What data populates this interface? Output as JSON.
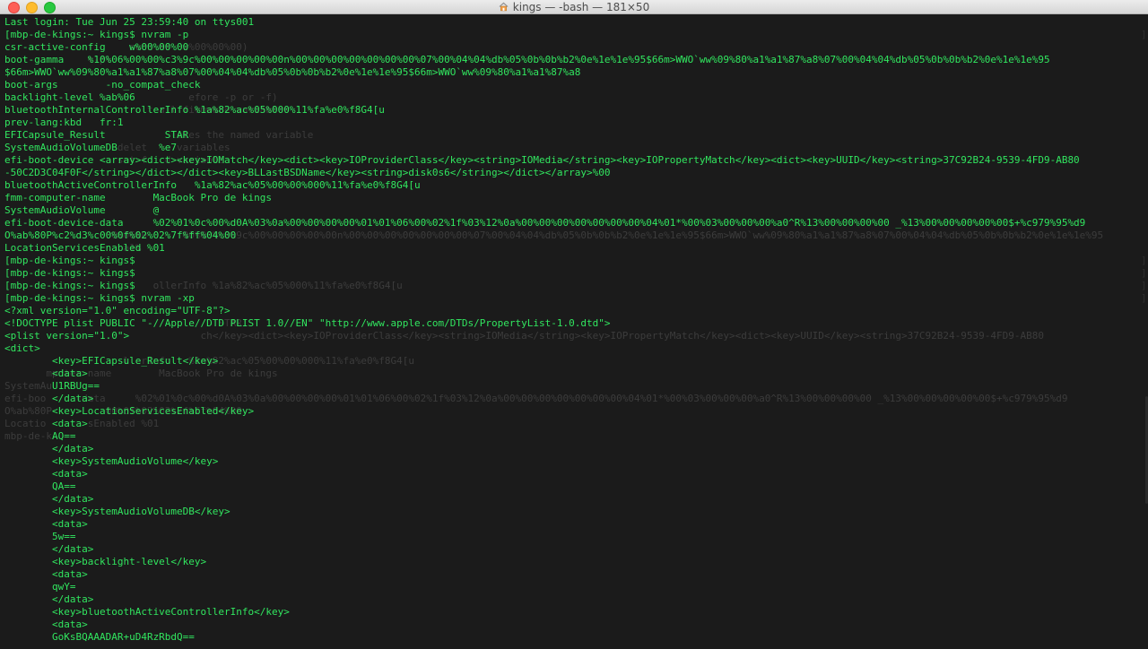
{
  "window": {
    "title": "kings — -bash — 181×50"
  },
  "terminal": {
    "lines": [
      "Last login: Tue Jun 25 23:59:40 on ttys001",
      "[mbp-de-kings:~ kings$ nvram -p",
      "csr-active-config    w%00%00%00",
      "boot-gamma    %10%06%00%00%c3%9c%00%00%00%00%00n%00%00%00%00%00%00%00%07%00%04%04%db%05%0b%0b%b2%0e%1e%1e%95$66m>WWO`ww%09%80%a1%a1%87%a8%07%00%04%04%db%05%0b%0b%b2%0e%1e%1e%95",
      "$66m>WWO`ww%09%80%a1%a1%87%a8%07%00%04%04%db%05%0b%0b%b2%0e%1e%1e%95$66m>WWO`ww%09%80%a1%a1%87%a8",
      "boot-args        -no_compat_check",
      "backlight-level %ab%06",
      "bluetoothInternalControllerInfo %1a%82%ac%05%000%11%fa%e0%f8G4[u",
      "prev-lang:kbd   fr:1",
      "EFICapsule_Result          STAR",
      "SystemAudioVolumeDB       %e7",
      "efi-boot-device <array><dict><key>IOMatch</key><dict><key>IOProviderClass</key><string>IOMedia</string><key>IOPropertyMatch</key><dict><key>UUID</key><string>37C92B24-9539-4FD9-AB80",
      "-50C2D3C04F0F</string></dict></dict><key>BLLastBSDName</key><string>disk0s6</string></dict></array>%00",
      "bluetoothActiveControllerInfo   %1a%82%ac%05%00%00%000%11%fa%e0%f8G4[u",
      "fmm-computer-name        MacBook Pro de kings",
      "SystemAudioVolume        @",
      "efi-boot-device-data     %02%01%0c%00%d0A%03%0a%00%00%00%00%01%01%06%00%02%1f%03%12%0a%00%00%00%00%00%00%00%04%01*%00%03%00%00%00%a0^R%13%00%00%00%00 _%13%00%00%00%00%00$+%c979%95%d9",
      "O%ab%80P%c2%d3%c00%0f%02%02%7f%ff%04%00",
      "LocationServicesEnabled %01",
      "[mbp-de-kings:~ kings$",
      "[mbp-de-kings:~ kings$",
      "[mbp-de-kings:~ kings$",
      "[mbp-de-kings:~ kings$ nvram -xp",
      "<?xml version=\"1.0\" encoding=\"UTF-8\"?>",
      "<!DOCTYPE plist PUBLIC \"-//Apple//DTD PLIST 1.0//EN\" \"http://www.apple.com/DTDs/PropertyList-1.0.dtd\">",
      "<plist version=\"1.0\">",
      "<dict>",
      "        <key>EFICapsule_Result</key>",
      "        <data>",
      "        U1RBUg==",
      "        </data>",
      "        <key>LocationServicesEnabled</key>",
      "        <data>",
      "        AQ==",
      "        </data>",
      "        <key>SystemAudioVolume</key>",
      "        <data>",
      "        QA==",
      "        </data>",
      "        <key>SystemAudioVolumeDB</key>",
      "        <data>",
      "        5w==",
      "        </data>",
      "        <key>backlight-level</key>",
      "        <data>",
      "        qwY=",
      "        </data>",
      "        <key>bluetoothActiveControllerInfo</key>",
      "        <data>",
      "        GoKsBQAAADAR+uD4RzRbdQ=="
    ],
    "ghost_lines": [
      {
        "row": 2,
        "text": "                     such as  w%00%00%00)"
      },
      {
        "row": 3,
        "text": "              t-pl"
      },
      {
        "row": 6,
        "text": "                               efore -p or -f)"
      },
      {
        "row": 7,
        "text": "                        t all firmware variables"
      },
      {
        "row": 9,
        "text": "                            letes the named variable"
      },
      {
        "row": 10,
        "text": "                   delet     variables"
      },
      {
        "row": 11,
        "text": "                   set f   d variable"
      },
      {
        "row": 17,
        "text": "                 ^0%06%0      00%00%c3%9c%00%00%00%00%00n%00%00%00%00%00%00%00%07%00%04%04%db%05%0b%0b%b2%0e%1e%1e%95$66m>WWO`ww%09%80%a1%a1%87%a8%07%00%04%04%db%05%0b%0b%b2%0e%1e%1e%95"
      },
      {
        "row": 18,
        "text": "                    a1%"
      },
      {
        "row": 21,
        "text": "                         ollerInfo %1a%82%ac%05%000%11%fa%e0%f8G4[u"
      },
      {
        "row": 23,
        "text": "                                                                                                                                                                                     "
      },
      {
        "row": 24,
        "text": "                                    STAR"
      },
      {
        "row": 25,
        "text": "                                 ch</key><dict><key>IOProviderClass</key><string>IOMedia</string><key>IOPropertyMatch</key><dict><key>UUID</key><string>37C92B24-9539-4FD9-AB80"
      },
      {
        "row": 27,
        "text": "                    llerInfo   %1a%82%ac%05%00%00%000%11%fa%e0%f8G4[u"
      },
      {
        "row": 28,
        "text": "       mputer-name        MacBook Pro de kings"
      },
      {
        "row": 29,
        "text": "SystemAu"
      },
      {
        "row": 30,
        "text": "efi-boo     -data     %02%01%0c%00%d0A%03%0a%00%00%00%00%01%01%06%00%02%1f%03%12%0a%00%00%00%00%00%00%00%04%01*%00%03%00%00%00%a0^R%13%00%00%00%00 _%13%00%00%00%00%00$+%c979%95%d9"
      },
      {
        "row": 31,
        "text": "O%ab%80P         00%0f%02%02%7f%ff%04%00"
      },
      {
        "row": 32,
        "text": "Locatio       sEnabled %01"
      },
      {
        "row": 33,
        "text": "mbp-de-k"
      }
    ]
  }
}
